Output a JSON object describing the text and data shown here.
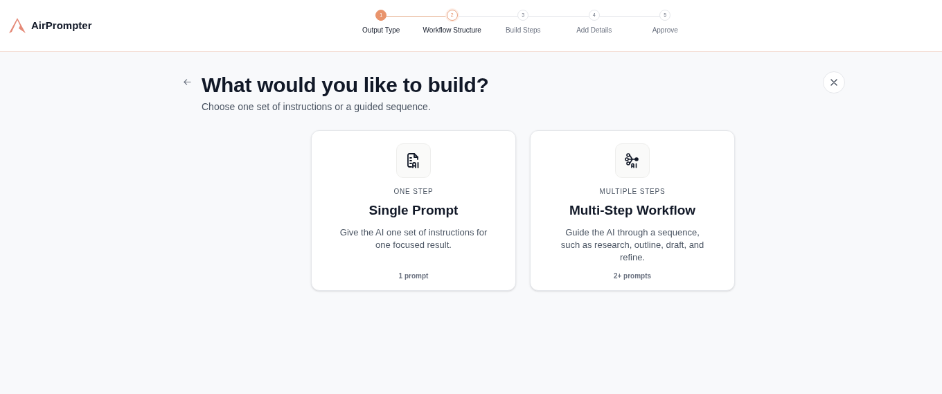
{
  "brand": {
    "name": "AirPrompter"
  },
  "steps": [
    {
      "number": "1",
      "label": "Output Type",
      "completed": true,
      "selected": false
    },
    {
      "number": "2",
      "label": "Workflow Structure",
      "completed": false,
      "selected": true
    },
    {
      "number": "3",
      "label": "Build Steps",
      "completed": false,
      "selected": false
    },
    {
      "number": "4",
      "label": "Add Details",
      "completed": false,
      "selected": false
    },
    {
      "number": "5",
      "label": "Approve",
      "completed": false,
      "selected": false
    }
  ],
  "heading": {
    "title": "What would you like to build?",
    "subtitle": "Choose one set of instructions or a guided sequence."
  },
  "options": [
    {
      "kind": "single",
      "eyebrow": "ONE STEP",
      "title": "Single Prompt",
      "description": "Give the AI one set of instructions for one focused result.",
      "count": "1 prompt"
    },
    {
      "kind": "multi",
      "eyebrow": "MULTIPLE STEPS",
      "title": "Multi-Step Workflow",
      "description": "Guide the AI through a sequence, such as research, outline, draft, and refine.",
      "count": "2+ prompts"
    }
  ]
}
